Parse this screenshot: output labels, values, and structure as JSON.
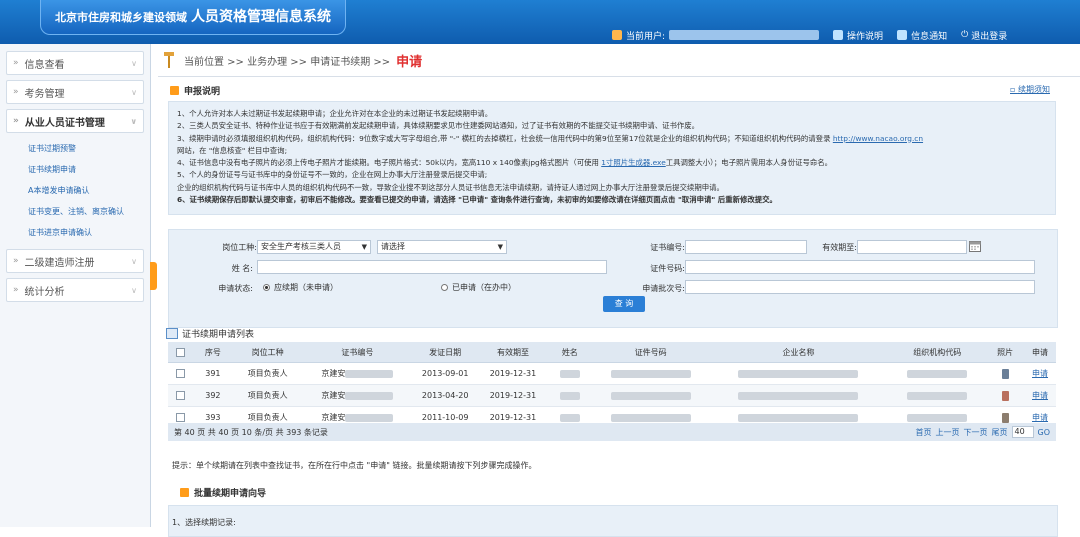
{
  "header": {
    "org": "北京市住房和城乡建设领域",
    "system": "人员资格管理信息系统",
    "current_user_label": "当前用户:",
    "help": "操作说明",
    "messages": "信息通知",
    "logout": "退出登录"
  },
  "sidebar": {
    "items": [
      {
        "label": "信息查看"
      },
      {
        "label": "考务管理"
      },
      {
        "label": "从业人员证书管理"
      },
      {
        "label": "二级建造师注册"
      },
      {
        "label": "统计分析"
      }
    ],
    "subitems": [
      {
        "label": "证书过期预警"
      },
      {
        "label": "证书续期申请"
      },
      {
        "label": "A本增发申请确认"
      },
      {
        "label": "证书变更、注销、离京确认"
      },
      {
        "label": "证书进京申请确认"
      }
    ]
  },
  "breadcrumb": {
    "path": "当前位置 >> 业务办理 >> 申请证书续期 >>",
    "current": "申请"
  },
  "notice": {
    "title": "申报说明",
    "link": "续期须知",
    "lines": [
      "1、个人允许对本人未过期证书发起续期申请；企业允许对在本企业的未过期证书发起续期申请。",
      "2、三类人员安全证书、特种作业证书应于有效期满前发起续期申请，具体续期要求见市住建委网站通知，过了证书有效期的不能提交证书续期申请、证书作废。",
      "3、续期申请时必须填报组织机构代码，组织机构代码：9位数字或大写字母组合,带 \"-\" 横杠的去掉横杠，社会统一信用代码中的第9位至第17位就是企业的组织机构代码；不知道组织机构代码的请登录",
      "网站，在 \"信息核查\" 栏目中查询;",
      "4、证书信息中没有电子照片的必须上传电子照片才能续期。电子照片格式：50k以内，宽高110 x 140像素jpg格式图片（可使用",
      "工具调整大小）；电子照片需用本人身份证号命名。",
      "5、个人的身份证号与证书库中的身份证号不一致的，企业在网上办事大厅注册登录后提交申请;",
      "企业的组织机构代码与证书库中人员的组织机构代码不一致，导致企业搜不到这部分人员证书信息无法申请续期，请持证人通过网上办事大厅注册登录后提交续期申请。",
      "6、证书续期保存后即默认提交审查，初审后不能修改。要查看已提交的申请，请选择 \"已申请\" 查询条件进行查询，未初审的如要修改请在详细页面点击 \"取消申请\" 后重新修改提交。"
    ],
    "url": "http://www.nacao.org.cn",
    "tool": "1寸照片生成器.exe"
  },
  "search": {
    "job_type_label": "岗位工种:",
    "job_type_value": "安全生产考核三类人员",
    "job_sub_value": "请选择",
    "cert_no_label": "证书编号:",
    "valid_to_label": "有效期至:",
    "name_label": "姓 名:",
    "id_no_label": "证件号码:",
    "status_label": "申请状态:",
    "status_options": [
      "应续期（未申请）",
      "已申请（在办中）"
    ],
    "batch_label": "申请批次号:",
    "query_button": "查 询"
  },
  "list": {
    "title": "证书续期申请列表",
    "columns": [
      "序号",
      "岗位工种",
      "证书编号",
      "发证日期",
      "有效期至",
      "姓名",
      "证件号码",
      "企业名称",
      "组织机构代码",
      "照片",
      "申请"
    ],
    "rows": [
      {
        "no": "391",
        "job": "项目负责人",
        "cert": "京建安",
        "issue": "2013-09-01",
        "expire": "2019-12-31",
        "apply": "申请"
      },
      {
        "no": "392",
        "job": "项目负责人",
        "cert": "京建安",
        "issue": "2013-04-20",
        "expire": "2019-12-31",
        "apply": "申请"
      },
      {
        "no": "393",
        "job": "项目负责人",
        "cert": "京建安",
        "issue": "2011-10-09",
        "expire": "2019-12-31",
        "apply": "申请"
      }
    ]
  },
  "pager": {
    "summary": "第 40 页  共 40 页   10 条/页   共 393 条记录",
    "first": "首页",
    "prev": "上一页",
    "next": "下一页",
    "last": "尾页",
    "page": "40",
    "go": "GO"
  },
  "tip": "提示：单个续期请在列表中查找证书，在所在行中点击 \"申请\" 链接。批量续期请按下列步骤完成操作。",
  "batch": {
    "title": "批量续期申请向导",
    "step1": "1、选择续期记录:"
  },
  "colors": {
    "header": "#1565c0",
    "accent": "#ff9c1a",
    "link": "#2a6ab0",
    "current": "#e03030"
  }
}
